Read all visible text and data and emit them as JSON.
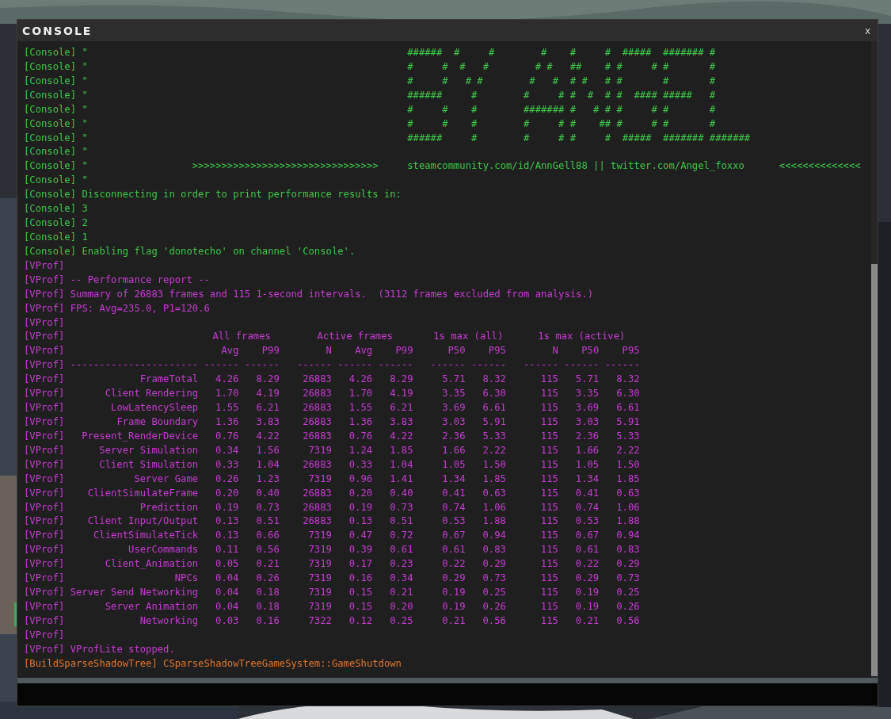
{
  "window": {
    "title": "CONSOLE",
    "close_button": "x"
  },
  "log": [
    {
      "channel": "[Console]",
      "text": "\"                                                       ######  #     #        #    #     #  #####  ####### #",
      "color": "#3fc84a"
    },
    {
      "channel": "[Console]",
      "text": "\"                                                       #     #  #   #        # #   ##    # #     # #       #",
      "color": "#3fc84a"
    },
    {
      "channel": "[Console]",
      "text": "\"                                                       #     #   # #        #   #  # #   # #       #       #",
      "color": "#3fc84a"
    },
    {
      "channel": "[Console]",
      "text": "\"                                                       ######     #        #     # #  #  # #  #### #####   #",
      "color": "#3fc84a"
    },
    {
      "channel": "[Console]",
      "text": "\"                                                       #     #    #        ####### #   # # #     # #       #",
      "color": "#3fc84a"
    },
    {
      "channel": "[Console]",
      "text": "\"                                                       #     #    #        #     # #    ## #     # #       #",
      "color": "#3fc84a"
    },
    {
      "channel": "[Console]",
      "text": "\"                                                       ######     #        #     # #     #  #####  ####### #######",
      "color": "#3fc84a"
    },
    {
      "channel": "[Console]",
      "text": "\"",
      "color": "#3fc84a"
    },
    {
      "channel": "[Console]",
      "text": "\"                  >>>>>>>>>>>>>>>>>>>>>>>>>>>>>>>>     steamcommunity.com/id/AnnGell88 || twitter.com/Angel_foxxo      <<<<<<<<<<<<<<",
      "color": "#3fc84a"
    },
    {
      "channel": "[Console]",
      "text": "\"",
      "color": "#3fc84a"
    },
    {
      "channel": "[Console]",
      "text": "Disconnecting in order to print performance results in:",
      "color": "#3fc84a"
    },
    {
      "channel": "[Console]",
      "text": "3",
      "color": "#3fc84a"
    },
    {
      "channel": "[Console]",
      "text": "2",
      "color": "#3fc84a"
    },
    {
      "channel": "[Console]",
      "text": "1",
      "color": "#3fc84a"
    },
    {
      "channel": "[Console]",
      "text": "Enabling flag 'donotecho' on channel 'Console'.",
      "color": "#3fc84a"
    },
    {
      "channel": "[VProf]",
      "color": "#c83cd4"
    },
    {
      "channel": "[VProf]",
      "text": "-- Performance report --",
      "color": "#c83cd4"
    },
    {
      "channel": "[VProf]",
      "text": "Summary of 26883 frames and 115 1-second intervals.  (3112 frames excluded from analysis.)",
      "color": "#c83cd4"
    },
    {
      "channel": "[VProf]",
      "text": "FPS: Avg=235.0, P1=120.6",
      "color": "#c83cd4"
    },
    {
      "channel": "[VProf]",
      "color": "#c83cd4"
    }
  ],
  "report_table": {
    "color": "#c83cd4",
    "group_row": {
      "channel": "[VProf]",
      "header_channel": "[VProf]",
      "groups": [
        {
          "label": "All frames",
          "columns": [
            "Avg",
            "P99"
          ]
        },
        {
          "label": "Active frames",
          "columns": [
            "N",
            "Avg",
            "P99"
          ]
        },
        {
          "label": "1s max (all)",
          "columns": [
            "P50",
            "P95"
          ]
        },
        {
          "label": "1s max (active)",
          "columns": [
            "N",
            "P50",
            "P95"
          ]
        }
      ]
    },
    "rule_row": {
      "channel": "[VProf]",
      "text": "---------------------- ------ ------   ------ ------ ------   ------ ------   ------ ------ ------"
    },
    "rows": [
      {
        "channel": "[VProf]",
        "name": "FrameTotal",
        "values": [
          "4.26",
          "8.29",
          "26883",
          "4.26",
          "8.29",
          "5.71",
          "8.32",
          "115",
          "5.71",
          "8.32"
        ]
      },
      {
        "channel": "[VProf]",
        "name": "Client Rendering",
        "values": [
          "1.70",
          "4.19",
          "26883",
          "1.70",
          "4.19",
          "3.35",
          "6.30",
          "115",
          "3.35",
          "6.30"
        ]
      },
      {
        "channel": "[VProf]",
        "name": "LowLatencySleep",
        "values": [
          "1.55",
          "6.21",
          "26883",
          "1.55",
          "6.21",
          "3.69",
          "6.61",
          "115",
          "3.69",
          "6.61"
        ]
      },
      {
        "channel": "[VProf]",
        "name": "Frame Boundary",
        "values": [
          "1.36",
          "3.83",
          "26883",
          "1.36",
          "3.83",
          "3.03",
          "5.91",
          "115",
          "3.03",
          "5.91"
        ]
      },
      {
        "channel": "[VProf]",
        "name": "Present_RenderDevice",
        "values": [
          "0.76",
          "4.22",
          "26883",
          "0.76",
          "4.22",
          "2.36",
          "5.33",
          "115",
          "2.36",
          "5.33"
        ]
      },
      {
        "channel": "[VProf]",
        "name": "Server Simulation",
        "values": [
          "0.34",
          "1.56",
          "7319",
          "1.24",
          "1.85",
          "1.66",
          "2.22",
          "115",
          "1.66",
          "2.22"
        ]
      },
      {
        "channel": "[VProf]",
        "name": "Client Simulation",
        "values": [
          "0.33",
          "1.04",
          "26883",
          "0.33",
          "1.04",
          "1.05",
          "1.50",
          "115",
          "1.05",
          "1.50"
        ]
      },
      {
        "channel": "[VProf]",
        "name": "Server Game",
        "values": [
          "0.26",
          "1.23",
          "7319",
          "0.96",
          "1.41",
          "1.34",
          "1.85",
          "115",
          "1.34",
          "1.85"
        ]
      },
      {
        "channel": "[VProf]",
        "name": "ClientSimulateFrame",
        "values": [
          "0.20",
          "0.40",
          "26883",
          "0.20",
          "0.40",
          "0.41",
          "0.63",
          "115",
          "0.41",
          "0.63"
        ]
      },
      {
        "channel": "[VProf]",
        "name": "Prediction",
        "values": [
          "0.19",
          "0.73",
          "26883",
          "0.19",
          "0.73",
          "0.74",
          "1.06",
          "115",
          "0.74",
          "1.06"
        ]
      },
      {
        "channel": "[VProf]",
        "name": "Client Input/Output",
        "values": [
          "0.13",
          "0.51",
          "26883",
          "0.13",
          "0.51",
          "0.53",
          "1.88",
          "115",
          "0.53",
          "1.88"
        ]
      },
      {
        "channel": "[VProf]",
        "name": "ClientSimulateTick",
        "values": [
          "0.13",
          "0.66",
          "7319",
          "0.47",
          "0.72",
          "0.67",
          "0.94",
          "115",
          "0.67",
          "0.94"
        ]
      },
      {
        "channel": "[VProf]",
        "name": "UserCommands",
        "values": [
          "0.11",
          "0.56",
          "7319",
          "0.39",
          "0.61",
          "0.61",
          "0.83",
          "115",
          "0.61",
          "0.83"
        ]
      },
      {
        "channel": "[VProf]",
        "name": "Client_Animation",
        "values": [
          "0.05",
          "0.21",
          "7319",
          "0.17",
          "0.23",
          "0.22",
          "0.29",
          "115",
          "0.22",
          "0.29"
        ]
      },
      {
        "channel": "[VProf]",
        "name": "NPCs",
        "values": [
          "0.04",
          "0.26",
          "7319",
          "0.16",
          "0.34",
          "0.29",
          "0.73",
          "115",
          "0.29",
          "0.73"
        ]
      },
      {
        "channel": "[VProf]",
        "name": "Server Send Networking",
        "values": [
          "0.04",
          "0.18",
          "7319",
          "0.15",
          "0.21",
          "0.19",
          "0.25",
          "115",
          "0.19",
          "0.25"
        ]
      },
      {
        "channel": "[VProf]",
        "name": "Server Animation",
        "values": [
          "0.04",
          "0.18",
          "7319",
          "0.15",
          "0.20",
          "0.19",
          "0.26",
          "115",
          "0.19",
          "0.26"
        ]
      },
      {
        "channel": "[VProf]",
        "name": "Networking",
        "values": [
          "0.03",
          "0.16",
          "7322",
          "0.12",
          "0.25",
          "0.21",
          "0.56",
          "115",
          "0.21",
          "0.56"
        ]
      }
    ]
  },
  "log_after": [
    {
      "channel": "[VProf]",
      "color": "#c83cd4"
    },
    {
      "channel": "[VProf]",
      "text": "VProfLite stopped.",
      "color": "#c83cd4"
    },
    {
      "channel": "[BuildSparseShadowTree]",
      "text": "CSparseShadowTreeGameSystem::GameShutdown",
      "color": "#e0762e"
    }
  ]
}
